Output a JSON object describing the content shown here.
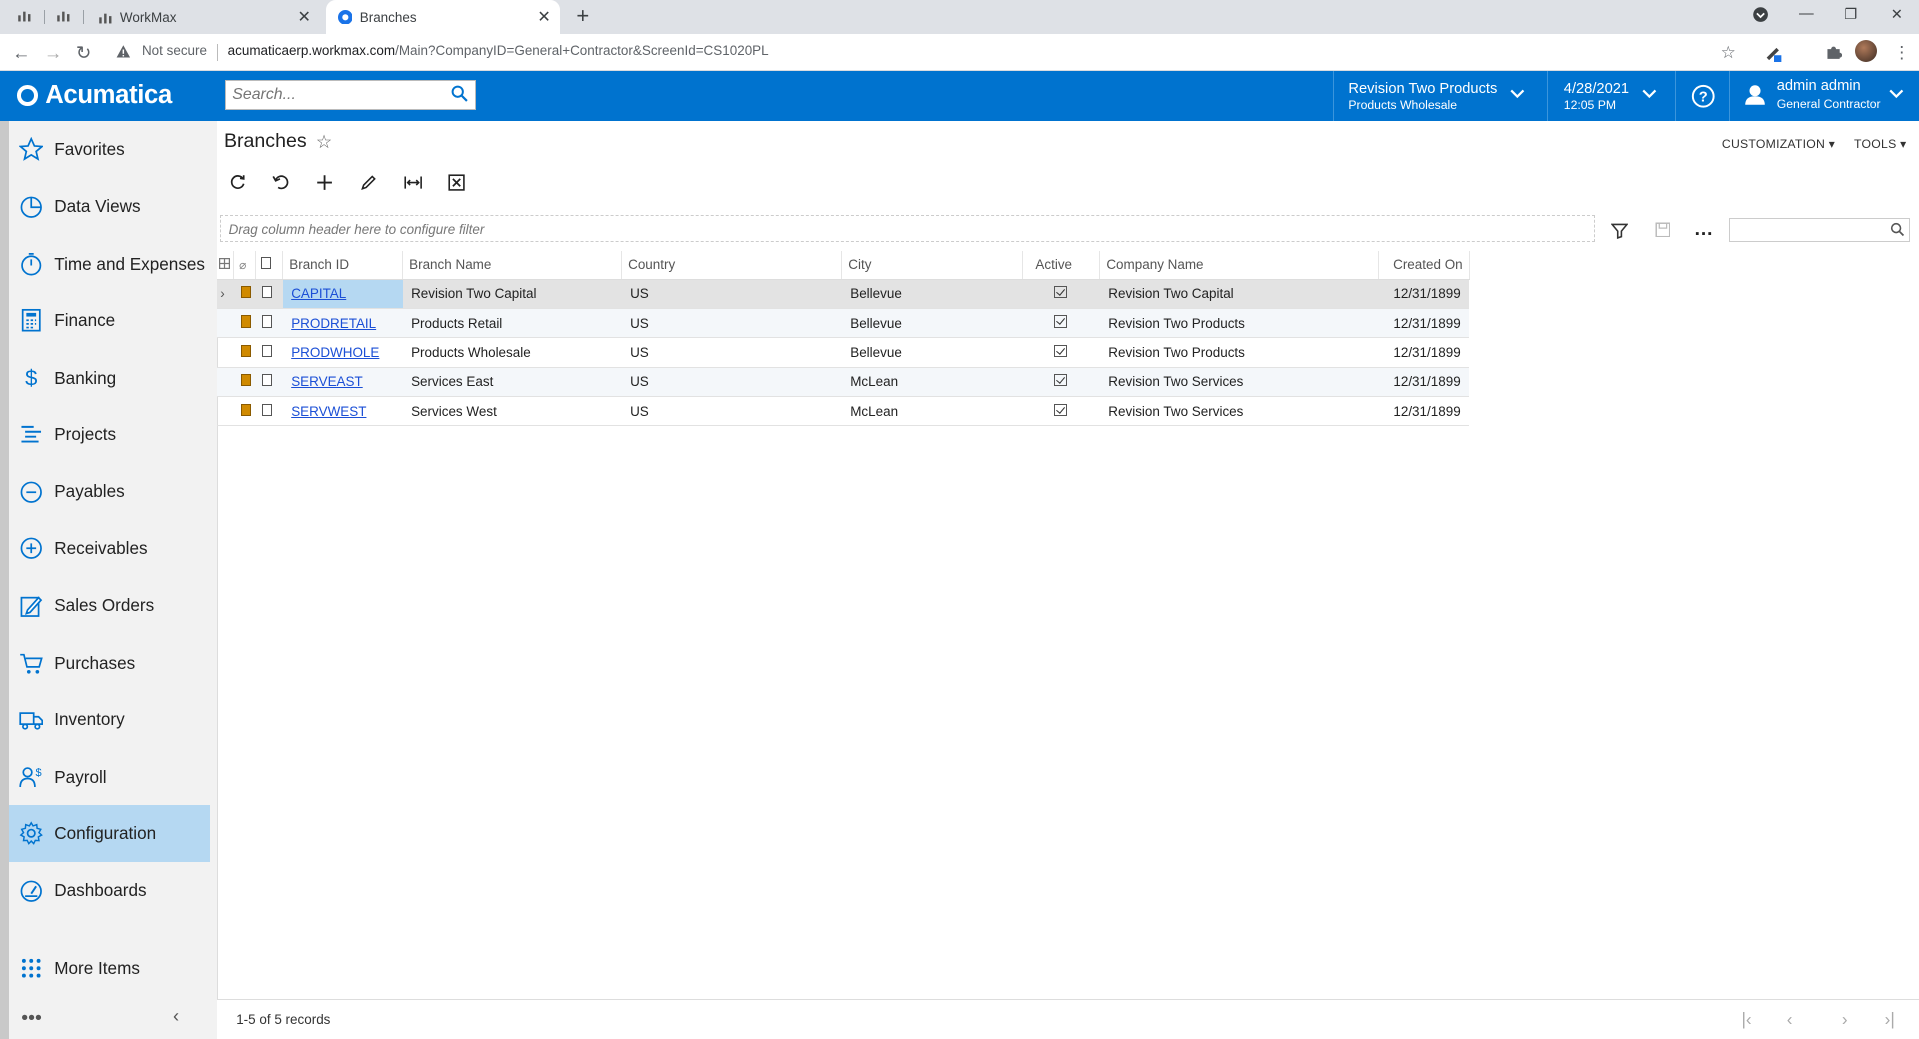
{
  "browser": {
    "tabs": [
      {
        "label": "WorkMax"
      },
      {
        "label": "Branches"
      }
    ],
    "security": "Not secure",
    "url_host": "acumaticaerp.workmax.com",
    "url_path": "/Main?CompanyID=General+Contractor&ScreenId=CS1020PL"
  },
  "header": {
    "logo": "Acumatica",
    "search_placeholder": "Search...",
    "branch_line1": "Revision Two Products",
    "branch_line2": "Products Wholesale",
    "date": "4/28/2021",
    "time": "12:05 PM",
    "user_name": "admin admin",
    "user_company": "General Contractor"
  },
  "sidebar": {
    "items": [
      {
        "label": "Favorites",
        "icon": "star-icon"
      },
      {
        "label": "Data Views",
        "icon": "pie-chart-icon"
      },
      {
        "label": "Time and Expenses",
        "icon": "stopwatch-icon"
      },
      {
        "label": "Finance",
        "icon": "calculator-icon"
      },
      {
        "label": "Banking",
        "icon": "dollar-icon"
      },
      {
        "label": "Projects",
        "icon": "projects-icon"
      },
      {
        "label": "Payables",
        "icon": "minus-circle-icon"
      },
      {
        "label": "Receivables",
        "icon": "plus-circle-icon"
      },
      {
        "label": "Sales Orders",
        "icon": "edit-icon"
      },
      {
        "label": "Purchases",
        "icon": "cart-icon"
      },
      {
        "label": "Inventory",
        "icon": "truck-icon"
      },
      {
        "label": "Payroll",
        "icon": "payroll-icon"
      },
      {
        "label": "Configuration",
        "icon": "gear-icon"
      },
      {
        "label": "Dashboards",
        "icon": "gauge-icon"
      },
      {
        "label": "More Items",
        "icon": "grid-dots-icon"
      }
    ],
    "selected": "Configuration"
  },
  "page": {
    "title": "Branches",
    "customization": "CUSTOMIZATION",
    "tools": "TOOLS",
    "filter_hint": "Drag column header here to configure filter",
    "records": "1-5 of 5 records"
  },
  "grid": {
    "columns": [
      "Branch ID",
      "Branch Name",
      "Country",
      "City",
      "Active",
      "Company Name",
      "Created On"
    ],
    "rows": [
      {
        "id": "CAPITAL",
        "name": "Revision Two Capital",
        "country": "US",
        "city": "Bellevue",
        "active": true,
        "company": "Revision Two Capital",
        "created": "12/31/1899"
      },
      {
        "id": "PRODRETAIL",
        "name": "Products Retail",
        "country": "US",
        "city": "Bellevue",
        "active": true,
        "company": "Revision Two Products",
        "created": "12/31/1899"
      },
      {
        "id": "PRODWHOLE",
        "name": "Products Wholesale",
        "country": "US",
        "city": "Bellevue",
        "active": true,
        "company": "Revision Two Products",
        "created": "12/31/1899"
      },
      {
        "id": "SERVEAST",
        "name": "Services East",
        "country": "US",
        "city": "McLean",
        "active": true,
        "company": "Revision Two Services",
        "created": "12/31/1899"
      },
      {
        "id": "SERVWEST",
        "name": "Services West",
        "country": "US",
        "city": "McLean",
        "active": true,
        "company": "Revision Two Services",
        "created": "12/31/1899"
      }
    ]
  }
}
